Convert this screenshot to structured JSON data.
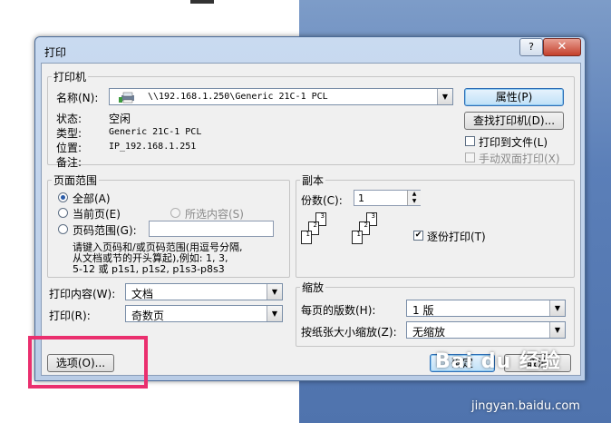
{
  "dialog": {
    "title": "打印",
    "help_label": "?",
    "close_label": "✕"
  },
  "printer": {
    "legend": "打印机",
    "name_label": "名称(N):",
    "name_value": "\\\\192.168.1.250\\Generic 21C-1 PCL",
    "status_label": "状态:",
    "status_value": "空闲",
    "type_label": "类型:",
    "type_value": "Generic 21C-1 PCL",
    "where_label": "位置:",
    "where_value": "IP_192.168.1.251",
    "comment_label": "备注:",
    "properties_label": "属性(P)",
    "find_printer_label": "查找打印机(D)...",
    "print_to_file_label": "打印到文件(L)",
    "manual_duplex_label": "手动双面打印(X)"
  },
  "page_range": {
    "legend": "页面范围",
    "all_label": "全部(A)",
    "current_label": "当前页(E)",
    "selection_label": "所选内容(S)",
    "pages_label": "页码范围(G):",
    "pages_value": "",
    "hint_line1": "请键入页码和/或页码范围(用逗号分隔,",
    "hint_line2": "从文档或节的开头算起),例如: 1, 3,",
    "hint_line3": "5-12 或 p1s1, p1s2, p1s3-p8s3"
  },
  "copies": {
    "legend": "副本",
    "count_label": "份数(C):",
    "count_value": "1",
    "collate_label": "逐份打印(T)",
    "page_numbers": [
      "1",
      "2",
      "3"
    ]
  },
  "print_what": {
    "label": "打印内容(W):",
    "value": "文档"
  },
  "print_pages": {
    "label": "打印(R):",
    "value": "奇数页"
  },
  "zoom": {
    "legend": "缩放",
    "pages_per_sheet_label": "每页的版数(H):",
    "pages_per_sheet_value": "1 版",
    "scale_label": "按纸张大小缩放(Z):",
    "scale_value": "无缩放"
  },
  "footer": {
    "options_label": "选项(O)...",
    "ok_label": "确定",
    "cancel_label": "取消"
  },
  "watermark": {
    "brand": "Bai du 经验",
    "url": "jingyan.baidu.com"
  },
  "colors": {
    "highlight": "#ea2f6e",
    "accent": "#2a5ba8"
  }
}
